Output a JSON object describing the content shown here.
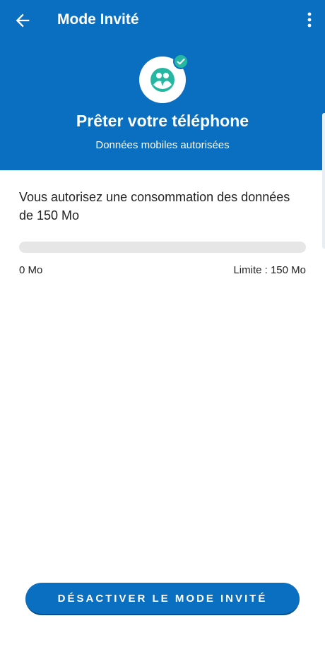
{
  "header": {
    "title": "Mode Invité",
    "back_icon": "arrow-left-icon",
    "menu_icon": "more-vert-icon"
  },
  "hero": {
    "icon": "guest-people-icon",
    "check_icon": "check-icon",
    "title": "Prêter votre téléphone",
    "subtitle": "Données mobiles autorisées"
  },
  "usage": {
    "description": "Vous autorisez une consommation des données de 150 Mo",
    "progress_fraction": 0,
    "min_label": "0 Mo",
    "max_label": "Limite : 150 Mo"
  },
  "footer": {
    "deactivate_label": "DÉSACTIVER LE MODE INVITÉ"
  },
  "colors": {
    "primary": "#0a6fc0",
    "accent": "#26b7a3",
    "track": "#e6e6e6"
  }
}
